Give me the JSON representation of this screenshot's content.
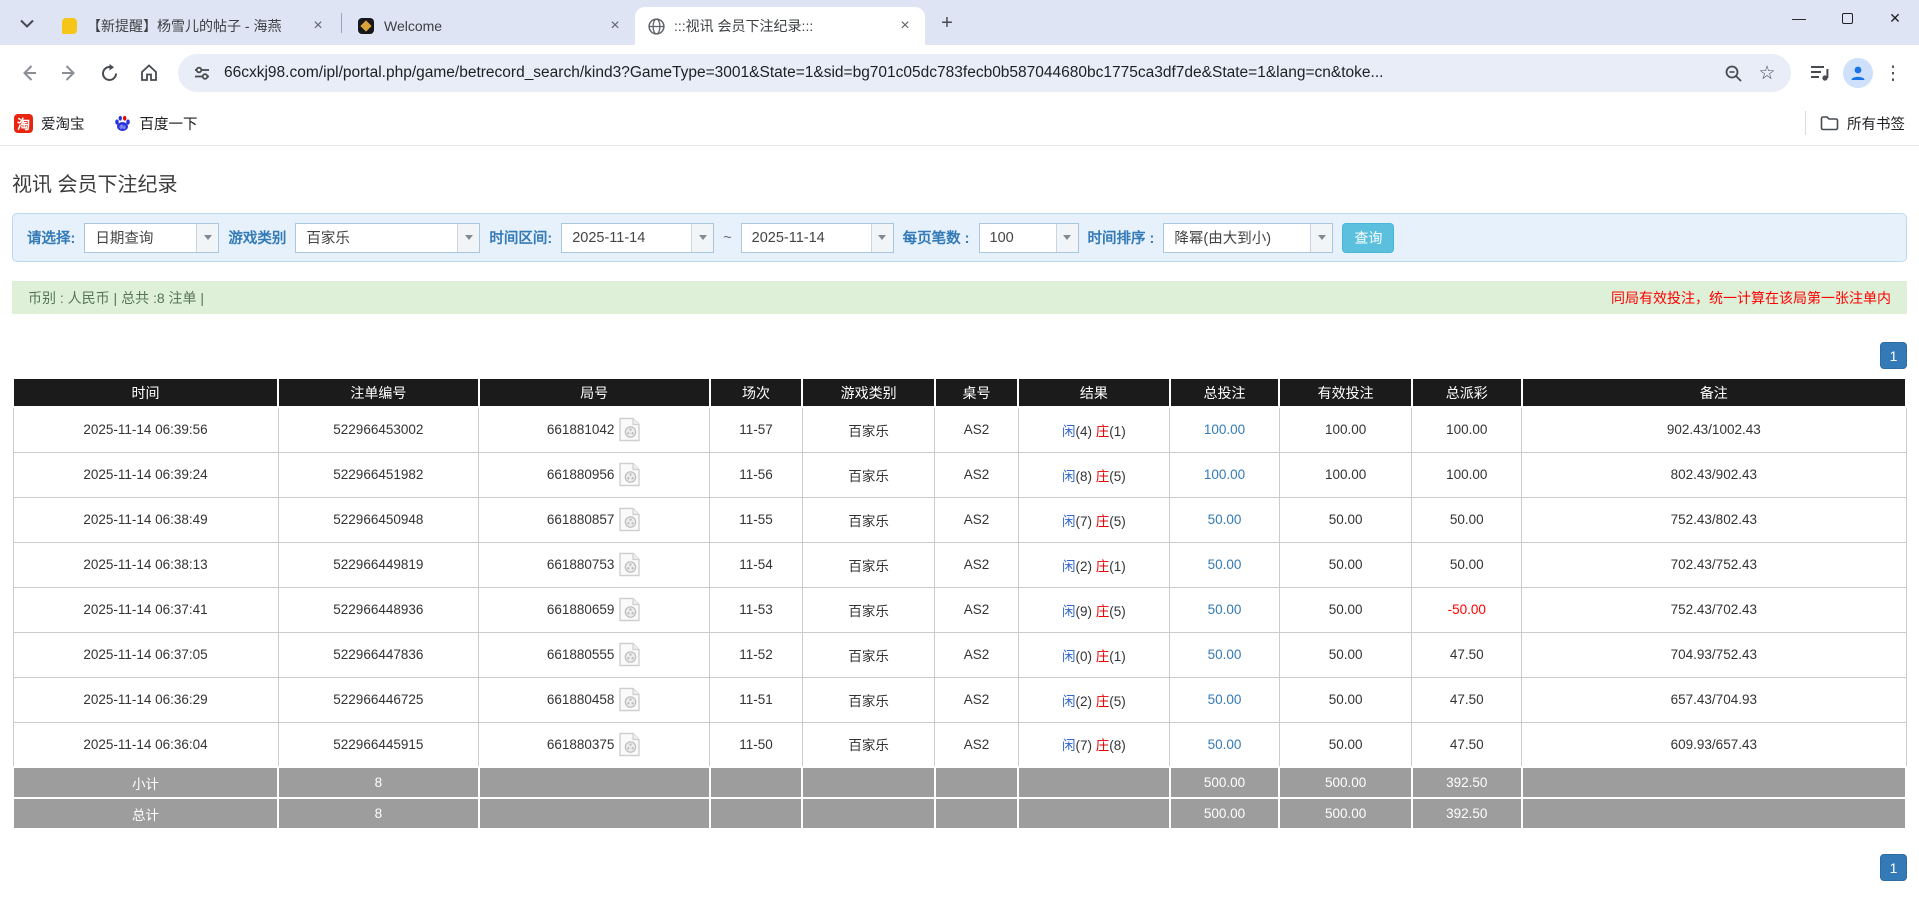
{
  "browser": {
    "tabs": [
      {
        "title": "【新提醒】杨雪儿的帖子 - 海燕",
        "close_glyph": "×"
      },
      {
        "title": "Welcome",
        "close_glyph": "×"
      },
      {
        "title": ":::视讯 会员下注纪录:::",
        "close_glyph": "×"
      }
    ],
    "new_tab_glyph": "+",
    "window": {
      "minimize_glyph": "—",
      "close_glyph": "✕"
    },
    "url": "66cxkj98.com/ipl/portal.php/game/betrecord_search/kind3?GameType=3001&State=1&sid=bg701c05dc783fecb0b587044680bc1775ca3df7de&State=1&lang=cn&toke...",
    "star_glyph": "☆",
    "menu_glyph": "⋮",
    "bookmarks": [
      {
        "label": "爱淘宝",
        "icon_text": "淘"
      },
      {
        "label": "百度一下"
      }
    ],
    "all_bookmarks_label": "所有书签"
  },
  "page": {
    "title": "视讯 会员下注纪录",
    "filters": {
      "select_label": "请选择:",
      "select_value": "日期查询",
      "game_type_label": "游戏类别",
      "game_type_value": "百家乐",
      "date_range_label": "时间区间:",
      "date_from": "2025-11-14",
      "tilde": "~",
      "date_to": "2025-11-14",
      "page_size_label": "每页笔数 :",
      "page_size_value": "100",
      "sort_label": "时间排序 :",
      "sort_value": "降幂(由大到小)",
      "search_button": "查询"
    },
    "infobar": {
      "left": "币别 : 人民币 | 总共 :8 注单 |",
      "right": "同局有效投注，统一计算在该局第一张注单内"
    },
    "pagination": {
      "page": "1"
    },
    "table": {
      "headers": [
        "时间",
        "注单编号",
        "局号",
        "场次",
        "游戏类别",
        "桌号",
        "结果",
        "总投注",
        "有效投注",
        "总派彩",
        "备注"
      ],
      "rows": [
        {
          "time": "2025-11-14 06:39:56",
          "bet_id": "522966453002",
          "round_id": "661881042",
          "session": "11-57",
          "game": "百家乐",
          "table_no": "AS2",
          "result": {
            "p": "闲",
            "pn": "(4)",
            "b": "庄",
            "bn": "(1)"
          },
          "total_bet": "100.00",
          "valid_bet": "100.00",
          "payout": "100.00",
          "note": "902.43/1002.43"
        },
        {
          "time": "2025-11-14 06:39:24",
          "bet_id": "522966451982",
          "round_id": "661880956",
          "session": "11-56",
          "game": "百家乐",
          "table_no": "AS2",
          "result": {
            "p": "闲",
            "pn": "(8)",
            "b": "庄",
            "bn": "(5)"
          },
          "total_bet": "100.00",
          "valid_bet": "100.00",
          "payout": "100.00",
          "note": "802.43/902.43"
        },
        {
          "time": "2025-11-14 06:38:49",
          "bet_id": "522966450948",
          "round_id": "661880857",
          "session": "11-55",
          "game": "百家乐",
          "table_no": "AS2",
          "result": {
            "p": "闲",
            "pn": "(7)",
            "b": "庄",
            "bn": "(5)"
          },
          "total_bet": "50.00",
          "valid_bet": "50.00",
          "payout": "50.00",
          "note": "752.43/802.43"
        },
        {
          "time": "2025-11-14 06:38:13",
          "bet_id": "522966449819",
          "round_id": "661880753",
          "session": "11-54",
          "game": "百家乐",
          "table_no": "AS2",
          "result": {
            "p": "闲",
            "pn": "(2)",
            "b": "庄",
            "bn": "(1)"
          },
          "total_bet": "50.00",
          "valid_bet": "50.00",
          "payout": "50.00",
          "note": "702.43/752.43"
        },
        {
          "time": "2025-11-14 06:37:41",
          "bet_id": "522966448936",
          "round_id": "661880659",
          "session": "11-53",
          "game": "百家乐",
          "table_no": "AS2",
          "result": {
            "p": "闲",
            "pn": "(9)",
            "b": "庄",
            "bn": "(5)"
          },
          "total_bet": "50.00",
          "valid_bet": "50.00",
          "payout": "-50.00",
          "note": "752.43/702.43"
        },
        {
          "time": "2025-11-14 06:37:05",
          "bet_id": "522966447836",
          "round_id": "661880555",
          "session": "11-52",
          "game": "百家乐",
          "table_no": "AS2",
          "result": {
            "p": "闲",
            "pn": "(0)",
            "b": "庄",
            "bn": "(1)"
          },
          "total_bet": "50.00",
          "valid_bet": "50.00",
          "payout": "47.50",
          "note": "704.93/752.43"
        },
        {
          "time": "2025-11-14 06:36:29",
          "bet_id": "522966446725",
          "round_id": "661880458",
          "session": "11-51",
          "game": "百家乐",
          "table_no": "AS2",
          "result": {
            "p": "闲",
            "pn": "(2)",
            "b": "庄",
            "bn": "(5)"
          },
          "total_bet": "50.00",
          "valid_bet": "50.00",
          "payout": "47.50",
          "note": "657.43/704.93"
        },
        {
          "time": "2025-11-14 06:36:04",
          "bet_id": "522966445915",
          "round_id": "661880375",
          "session": "11-50",
          "game": "百家乐",
          "table_no": "AS2",
          "result": {
            "p": "闲",
            "pn": "(7)",
            "b": "庄",
            "bn": "(8)"
          },
          "total_bet": "50.00",
          "valid_bet": "50.00",
          "payout": "47.50",
          "note": "609.93/657.43"
        }
      ],
      "subtotal": {
        "label": "小计",
        "count": "8",
        "total_bet": "500.00",
        "valid_bet": "500.00",
        "payout": "392.50"
      },
      "total": {
        "label": "总计",
        "count": "8",
        "total_bet": "500.00",
        "valid_bet": "500.00",
        "payout": "392.50"
      }
    }
  },
  "colors": {
    "accent_blue": "#337ab7",
    "search_button": "#5bc0de",
    "table_header_bg": "#1b1b1b",
    "summary_row_bg": "#9d9d9d",
    "info_bg": "#dff0d8",
    "player_blue": "#3366cc",
    "banker_red": "#e60000",
    "negative_red": "#ff0000"
  }
}
